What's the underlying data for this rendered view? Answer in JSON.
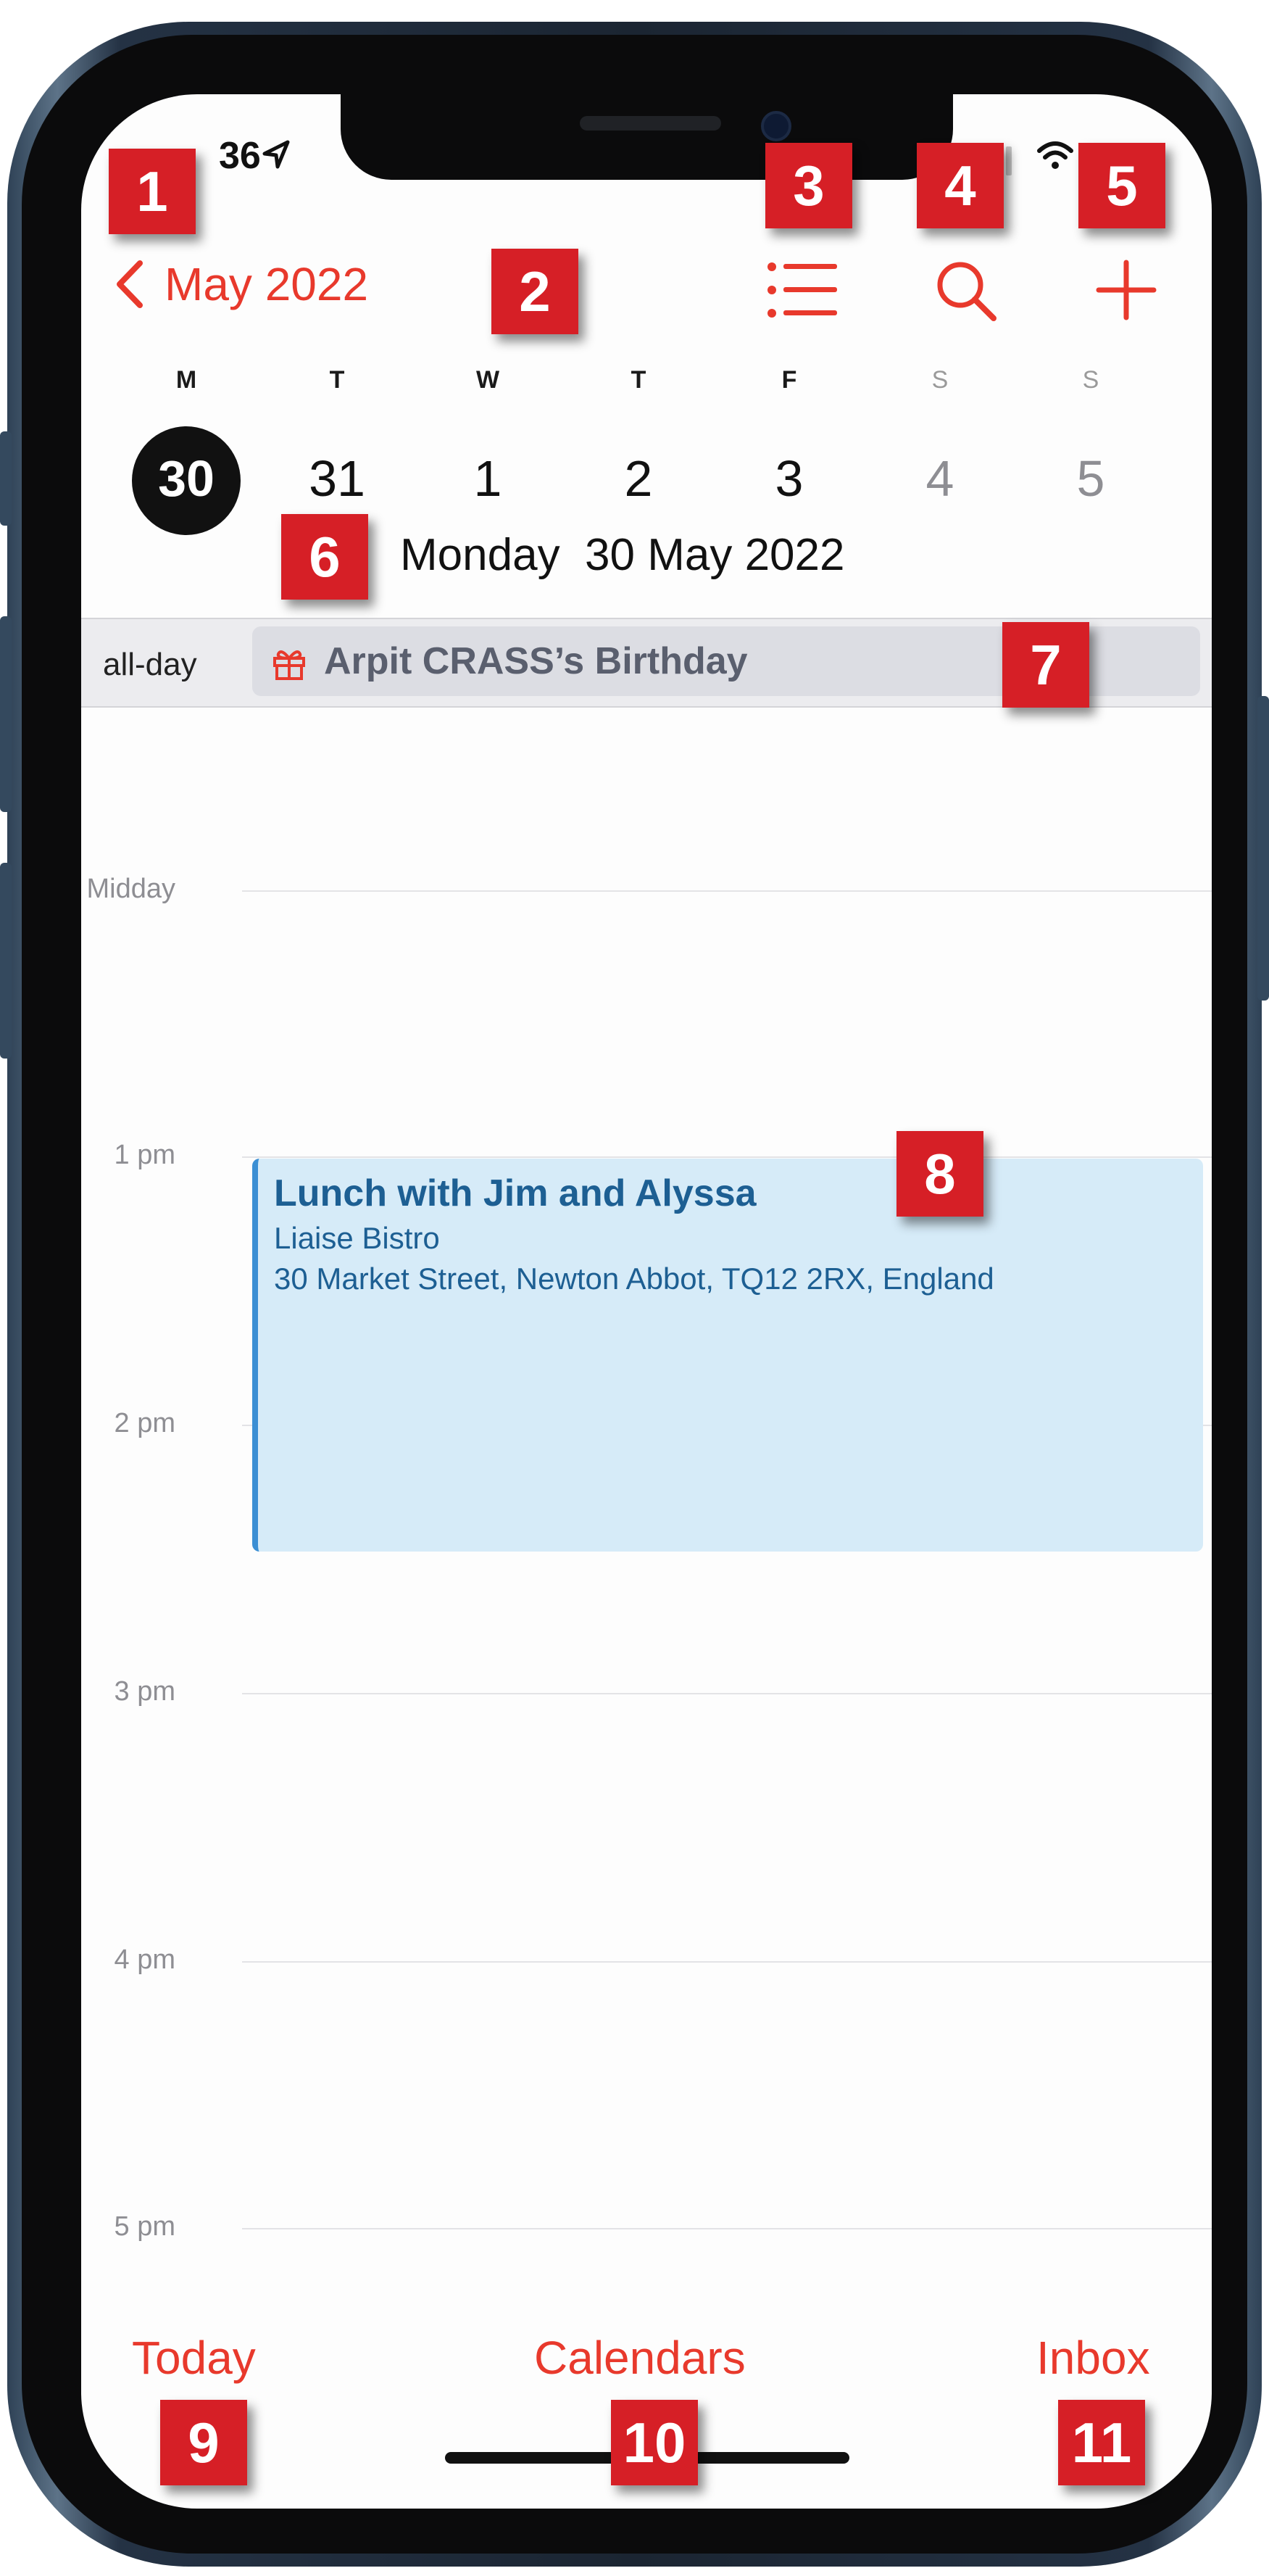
{
  "status_bar": {
    "time": "36"
  },
  "header": {
    "back_label": "May 2022"
  },
  "week": {
    "days": [
      {
        "letter": "M",
        "date": "30"
      },
      {
        "letter": "T",
        "date": "31"
      },
      {
        "letter": "W",
        "date": "1"
      },
      {
        "letter": "T",
        "date": "2"
      },
      {
        "letter": "F",
        "date": "3"
      },
      {
        "letter": "S",
        "date": "4"
      },
      {
        "letter": "S",
        "date": "5"
      }
    ],
    "selected_index": 0,
    "selected_day_label": "Monday  30 May 2022"
  },
  "all_day": {
    "label": "all-day",
    "event_title": "Arpit CRASS’s Birthday"
  },
  "timeline": {
    "hours": [
      "Midday",
      "1 pm",
      "2 pm",
      "3 pm",
      "4 pm",
      "5 pm"
    ]
  },
  "event": {
    "title": "Lunch with Jim and Alyssa",
    "location": "Liaise Bistro",
    "address": "30 Market Street, Newton Abbot, TQ12 2RX, England"
  },
  "tab_bar": {
    "today": "Today",
    "calendars": "Calendars",
    "inbox": "Inbox"
  },
  "markers": [
    "1",
    "2",
    "3",
    "4",
    "5",
    "6",
    "7",
    "8",
    "9",
    "10",
    "11"
  ],
  "colors": {
    "accent": "#e8392c",
    "marker": "#d61f26",
    "event_fill": "#d6ebf8",
    "event_bar": "#3b8fd4",
    "event_text": "#1d5f93"
  },
  "icons": {
    "location": "location-arrow-icon",
    "back": "chevron-left-icon",
    "list": "list-icon",
    "search": "search-icon",
    "add": "plus-icon",
    "gift": "gift-icon",
    "wifi": "wifi-icon"
  }
}
